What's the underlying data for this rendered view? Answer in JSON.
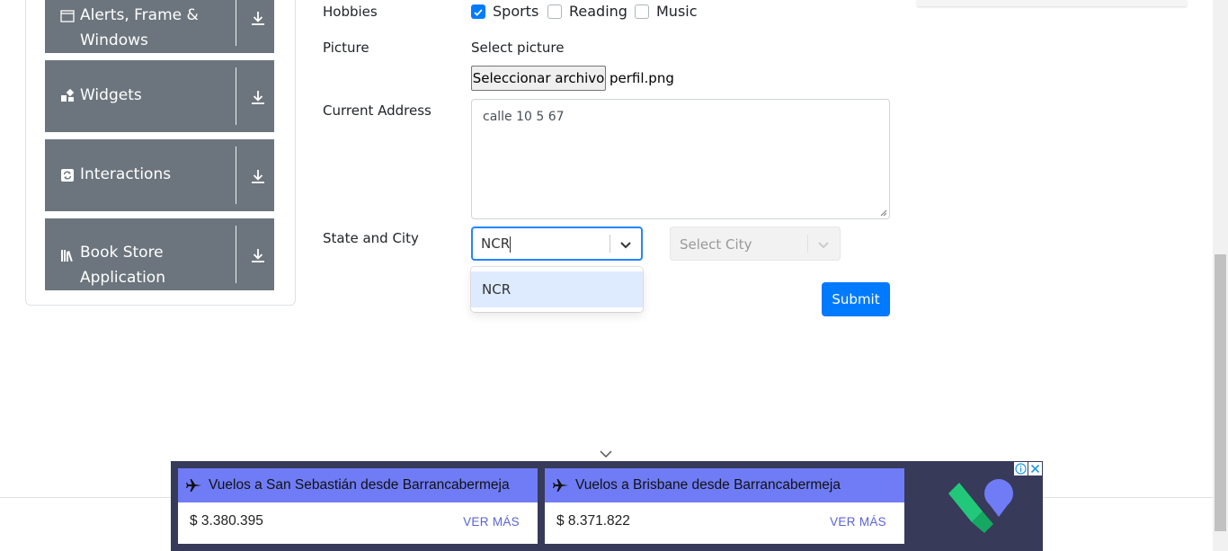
{
  "sidebar": {
    "groups": [
      {
        "label_line1": "Alerts, Frame &",
        "label_line2": "Windows",
        "icon": "window-icon"
      },
      {
        "label_line1": "Widgets",
        "label_line2": "",
        "icon": "widgets-icon"
      },
      {
        "label_line1": "Interactions",
        "label_line2": "",
        "icon": "interactions-icon"
      },
      {
        "label_line1": "Book Store",
        "label_line2": "Application",
        "icon": "books-icon"
      }
    ]
  },
  "form": {
    "hobbies_label": "Hobbies",
    "hobbies": [
      {
        "label": "Sports",
        "checked": true
      },
      {
        "label": "Reading",
        "checked": false
      },
      {
        "label": "Music",
        "checked": false
      }
    ],
    "picture_label": "Picture",
    "picture_hint": "Select picture",
    "file_button": "Seleccionar archivo",
    "file_name": "perfil.png",
    "address_label": "Current Address",
    "address_value": "calle 10 5 67",
    "state_city_label": "State and City",
    "state_input": "NCR",
    "state_option": "NCR",
    "city_placeholder": "Select City",
    "submit": "Submit"
  },
  "ad": {
    "cards": [
      {
        "title": "Vuelos a San Sebastián desde Barrancabermeja",
        "price": "$ 3.380.395",
        "cta": "VER MÁS"
      },
      {
        "title": "Vuelos a Brisbane desde Barrancabermeja",
        "price": "$ 8.371.822",
        "cta": "VER MÁS"
      }
    ]
  },
  "colors": {
    "primary": "#007bff",
    "sidebar_group": "#6c757d",
    "ad_bg": "#373a59",
    "ad_head": "#6f7cf6",
    "option_highlight": "#deebff"
  }
}
